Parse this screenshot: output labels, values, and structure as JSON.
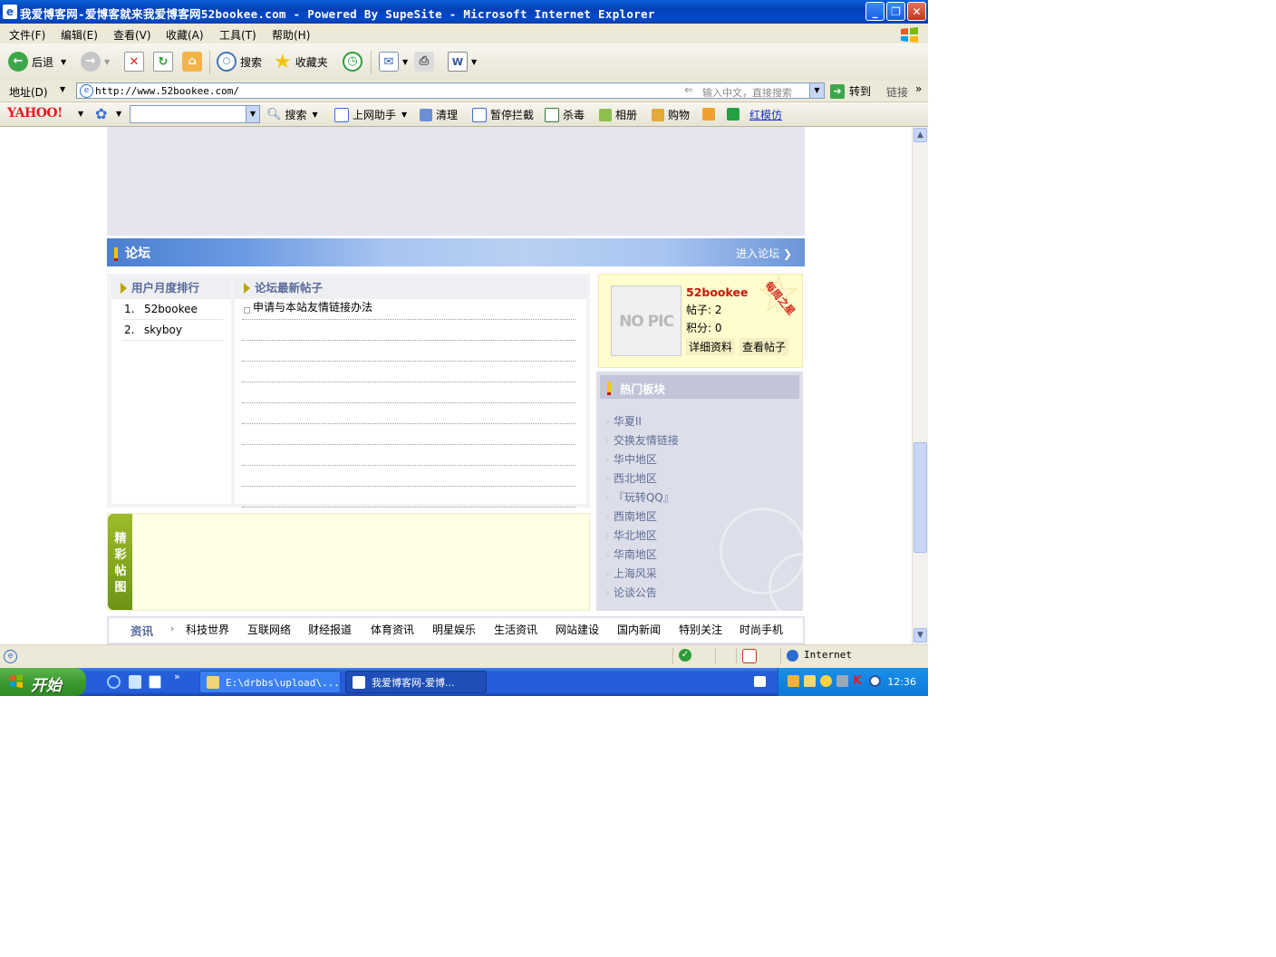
{
  "window": {
    "title": "我爱博客网-爱博客就来我爱博客网52bookee.com - Powered By SupeSite - Microsoft Internet Explorer",
    "minimize": "_",
    "restore": "❐",
    "close": "✕"
  },
  "menubar": {
    "items": [
      "文件(F)",
      "编辑(E)",
      "查看(V)",
      "收藏(A)",
      "工具(T)",
      "帮助(H)"
    ]
  },
  "toolbar": {
    "back": "后退",
    "search": "搜索",
    "favorites": "收藏夹"
  },
  "addressbar": {
    "label": "地址(D)",
    "url": "http://www.52bookee.com/",
    "placeholder": "输入中文，直接搜索",
    "go": "转到",
    "links": "链接"
  },
  "yahoobar": {
    "logo": "YAHOO!",
    "search": "搜索",
    "helper": "上网助手",
    "clean": "清理",
    "popup_block": "暂停拦截",
    "antivirus": "杀毒",
    "album": "相册",
    "shopping": "购物",
    "link": "红模仿"
  },
  "forum": {
    "section_title": "论坛",
    "enter_link": "进入论坛",
    "rank_title": "用户月度排行",
    "rank": [
      {
        "num": "1.",
        "name": "52bookee"
      },
      {
        "num": "2.",
        "name": "skyboy"
      }
    ],
    "posts_title": "论坛最新帖子",
    "posts": [
      "申请与本站友情链接办法",
      "",
      "",
      "",
      "",
      "",
      "",
      "",
      "",
      ""
    ],
    "jingcai_tag": [
      "精",
      "彩",
      "帖",
      "图"
    ]
  },
  "star": {
    "badge": "每周之星",
    "nopic": "NO PIC",
    "username": "52bookee",
    "posts_line": "帖子: 2",
    "points_line": "积分: 0",
    "profile_btn": "详细资料",
    "posts_btn": "查看帖子"
  },
  "hot": {
    "title": "热门板块",
    "items": [
      "华夏II",
      "交换友情链接",
      "华中地区",
      "西北地区",
      "『玩转QQ』",
      "西南地区",
      "华北地区",
      "华南地区",
      "上海风采",
      "论谈公告"
    ]
  },
  "navbar": {
    "label": "资讯",
    "arrow": "›",
    "items": [
      "科技世界",
      "互联网络",
      "财经报道",
      "体育资讯",
      "明星娱乐",
      "生活资讯",
      "网站建设",
      "国内新闻",
      "特别关注",
      "时尚手机"
    ]
  },
  "statusbar": {
    "zone": "Internet"
  },
  "taskbar": {
    "start": "开始",
    "tasks": [
      "E:\\drbbs\\upload\\...",
      "我爱博客网-爱博..."
    ],
    "clock": "12:36"
  }
}
